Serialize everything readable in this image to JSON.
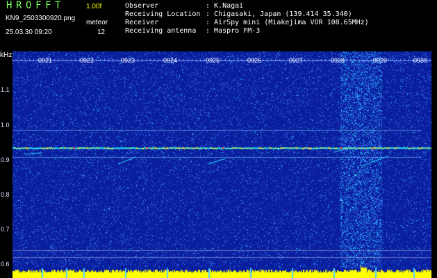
{
  "header": {
    "app_title": "HROFFT",
    "version": "1.00f",
    "filename": "KN9_2503300920.png",
    "datetime": "25.03.30 09:20",
    "meteor_label": "meteor",
    "meteor_count": "12"
  },
  "info": [
    {
      "label": "Observer",
      "value": ": K.Nagai"
    },
    {
      "label": "Receiving Location",
      "value": ": Chigasaki, Japan (139.414 35.340)"
    },
    {
      "label": "Receiver",
      "value": ": AirSpy mini (Miakejima VOR 108.65MHz)"
    },
    {
      "label": "Receiving antenna",
      "value": ": Maspro FM-3"
    }
  ],
  "spectrogram": {
    "unit": "kHz",
    "yticks": [
      "1.1",
      "1.0",
      "0.9",
      "0.8",
      "0.7",
      "0.6"
    ],
    "xticks": [
      "0921",
      "0922",
      "0923",
      "0924",
      "0925",
      "0926",
      "0927",
      "0928",
      "0929",
      "0930"
    ],
    "colors": {
      "background": "#0a1f9e",
      "noise": "#3d7cff",
      "echo": "#1fe0ff",
      "carrier": "#ffef33",
      "baseline": "#ffff00"
    }
  }
}
